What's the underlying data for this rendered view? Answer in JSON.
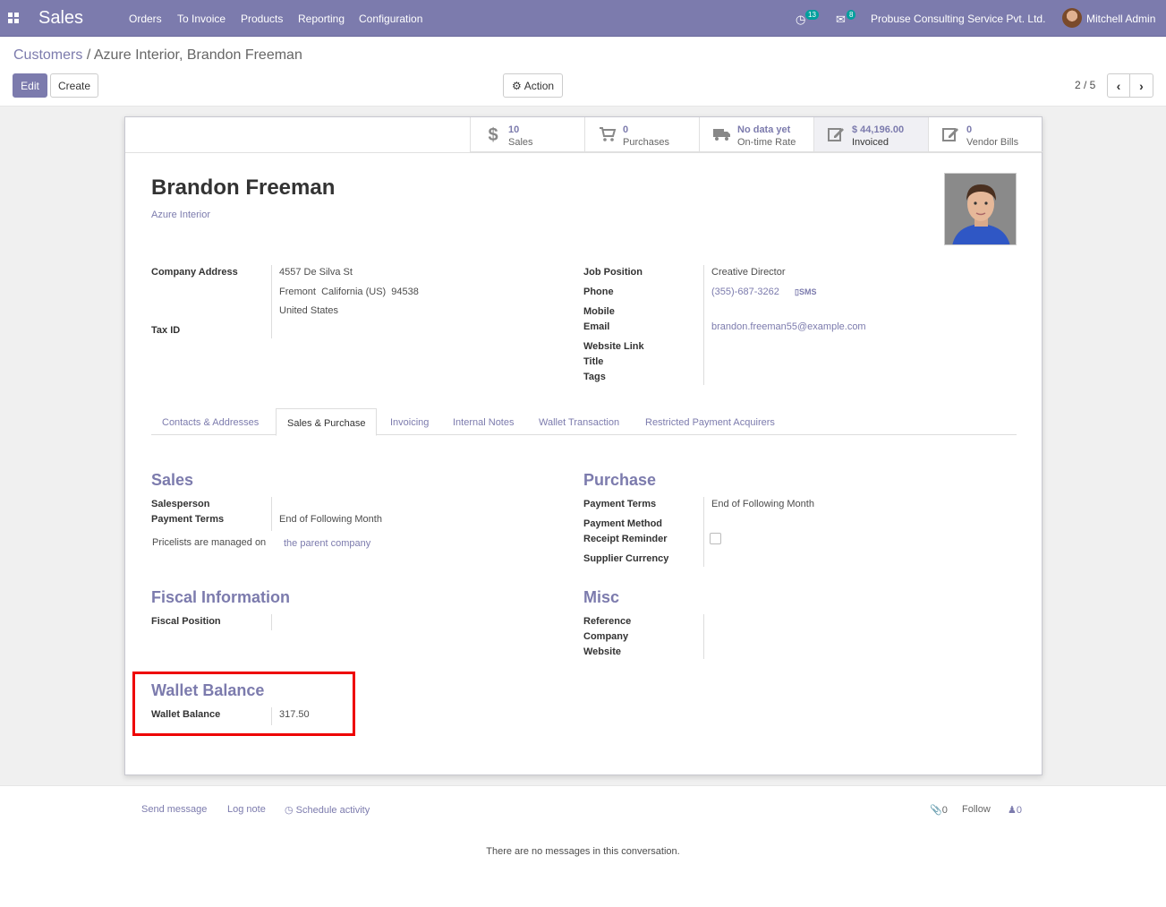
{
  "app": {
    "title": "Sales"
  },
  "menu": [
    {
      "label": "Orders"
    },
    {
      "label": "To Invoice"
    },
    {
      "label": "Products"
    },
    {
      "label": "Reporting"
    },
    {
      "label": "Configuration"
    }
  ],
  "systray": {
    "activity_count": "13",
    "message_count": "8",
    "company": "Probuse Consulting Service Pvt. Ltd.",
    "user": "Mitchell Admin"
  },
  "breadcrumb": {
    "parent": "Customers",
    "separator": "/",
    "current": "Azure Interior, Brandon Freeman"
  },
  "buttons": {
    "edit": "Edit",
    "create": "Create",
    "action": "Action"
  },
  "pager": {
    "value": "2 / 5"
  },
  "stats": [
    {
      "value": "10",
      "label": "Sales",
      "icon": "dollar-icon"
    },
    {
      "value": "0",
      "label": "Purchases",
      "icon": "cart-icon"
    },
    {
      "value": "No data yet",
      "label": "On-time Rate",
      "icon": "truck-icon"
    },
    {
      "value": "$ 44,196.00",
      "label": "Invoiced",
      "icon": "edit-icon"
    },
    {
      "value": "0",
      "label": "Vendor Bills",
      "icon": "edit-icon"
    }
  ],
  "partner": {
    "name": "Brandon Freeman",
    "parent_company": "Azure Interior",
    "address_label": "Company Address",
    "street": "4557 De Silva St",
    "city_line": "Fremont  California (US)  94538",
    "country": "United States",
    "tax_id_label": "Tax ID",
    "job_position_label": "Job Position",
    "job_position": "Creative Director",
    "phone_label": "Phone",
    "phone": "(355)-687-3262",
    "sms": "SMS",
    "mobile_label": "Mobile",
    "email_label": "Email",
    "email": "brandon.freeman55@example.com",
    "website_label": "Website Link",
    "title_label": "Title",
    "tags_label": "Tags"
  },
  "tabs": [
    {
      "label": "Contacts & Addresses"
    },
    {
      "label": "Sales & Purchase"
    },
    {
      "label": "Invoicing"
    },
    {
      "label": "Internal Notes"
    },
    {
      "label": "Wallet Transaction"
    },
    {
      "label": "Restricted Payment Acquirers"
    }
  ],
  "sales": {
    "title": "Sales",
    "salesperson_label": "Salesperson",
    "payment_terms_label": "Payment Terms",
    "payment_terms": "End of Following Month",
    "pricelist_text": "Pricelists are managed on",
    "pricelist_link": "the parent company"
  },
  "purchase": {
    "title": "Purchase",
    "payment_terms_label": "Payment Terms",
    "payment_terms": "End of Following Month",
    "payment_method_label": "Payment Method",
    "receipt_reminder_label": "Receipt Reminder",
    "supplier_currency_label": "Supplier Currency"
  },
  "fiscal": {
    "title": "Fiscal Information",
    "position_label": "Fiscal Position"
  },
  "misc": {
    "title": "Misc",
    "reference_label": "Reference",
    "company_label": "Company",
    "website_label": "Website"
  },
  "wallet": {
    "title": "Wallet Balance",
    "label": "Wallet Balance",
    "value": "317.50"
  },
  "chatter": {
    "send_message": "Send message",
    "log_note": "Log note",
    "schedule_activity": "Schedule activity",
    "attachments": "0",
    "follow": "Follow",
    "followers": "0",
    "empty": "There are no messages in this conversation."
  },
  "colors": {
    "brand": "#7c7bad",
    "highlight": "#e00000"
  }
}
